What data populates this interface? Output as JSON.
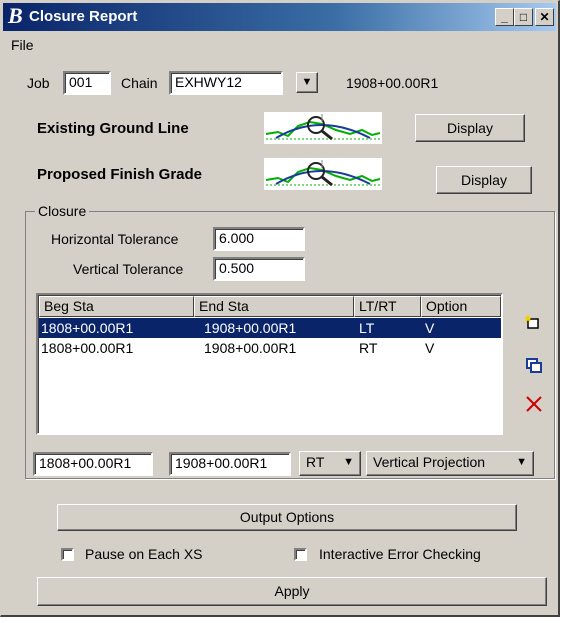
{
  "window": {
    "title": "Closure Report",
    "controls": [
      "_",
      "□",
      "✕"
    ]
  },
  "menu": {
    "file": "File"
  },
  "job": {
    "job_label": "Job",
    "job_value": "001",
    "chain_label": "Chain",
    "chain_value": "EXHWY12",
    "station_readout": "1908+00.00R1"
  },
  "existing_ground": {
    "label": "Existing Ground Line",
    "display_button": "Display"
  },
  "proposed_grade": {
    "label": "Proposed Finish Grade",
    "display_button": "Display"
  },
  "closure": {
    "group_label": "Closure",
    "horizontal_label": "Horizontal Tolerance",
    "horizontal_value": "6.000",
    "vertical_label": "Vertical Tolerance",
    "vertical_value": "0.500",
    "columns": [
      "Beg Sta",
      "End Sta",
      "LT/RT",
      "Option"
    ],
    "rows": [
      {
        "beg": "1808+00.00R1",
        "end": "1908+00.00R1",
        "side": "LT",
        "option": "V",
        "selected": true
      },
      {
        "beg": "1808+00.00R1",
        "end": "1908+00.00R1",
        "side": "RT",
        "option": "V",
        "selected": false
      }
    ],
    "edit_beg": "1808+00.00R1",
    "edit_end": "1908+00.00R1",
    "side_select": "RT",
    "projection_select": "Vertical Projection"
  },
  "icons": [
    "add-row-icon",
    "copy-row-icon",
    "delete-row-icon"
  ],
  "output_options_button": "Output Options",
  "pause_checkbox": {
    "label": "Pause on Each XS",
    "checked": false
  },
  "error_checkbox": {
    "label": "Interactive Error Checking",
    "checked": false
  },
  "apply_button": "Apply",
  "colors": {
    "title_bar": "#0a246a",
    "selection": "#0a246a",
    "delete": "#cc0000"
  }
}
